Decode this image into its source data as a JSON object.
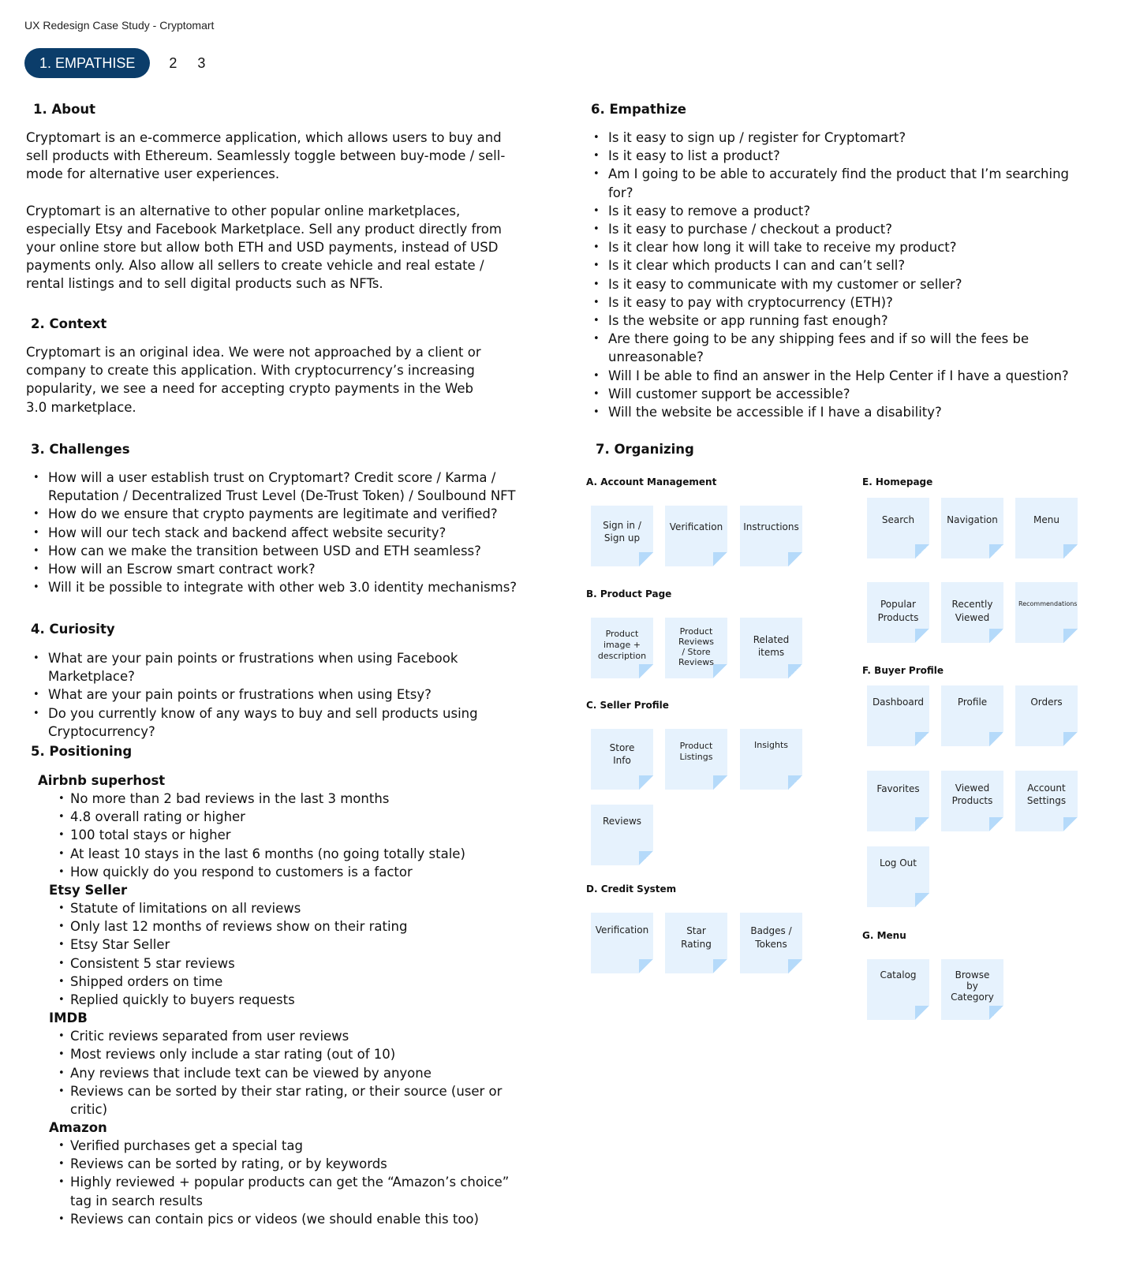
{
  "app_title": "UX Redesign Case Study - Cryptomart",
  "tabs": [
    {
      "label": "1. EMPATHISE",
      "active": true
    },
    {
      "label": "2",
      "active": false
    },
    {
      "label": "3",
      "active": false
    }
  ],
  "colors": {
    "tab_active_bg": "#0b3d6a",
    "sticky_bg": "#e6f2fd",
    "sticky_fold": "#b5dafa"
  },
  "about": {
    "heading": "1. About",
    "paragraphs": [
      "Cryptomart is an e-commerce application, which allows users to buy and sell products with Ethereum. Seamlessly toggle between buy-mode / sell-mode for alternative user experiences.",
      "Cryptomart is an alternative to other popular online marketplaces, especially Etsy and Facebook Marketplace. Sell any product directly from your online store but allow both ETH and USD payments, instead of USD payments only. Also allow all sellers to create vehicle and real estate / rental listings and to sell digital products such as NFTs."
    ]
  },
  "context": {
    "heading": "2. Context",
    "paragraph": "Cryptomart is an original idea. We were not approached by a client or company to create this application. With cryptocurrency’s increasing popularity, we see a need for accepting crypto payments in the Web 3.0 marketplace."
  },
  "challenges": {
    "heading": "3. Challenges",
    "items": [
      "How will a user establish trust on Cryptomart? Credit score / Karma / Reputation / Decentralized Trust Level (De-Trust Token) / Soulbound NFT",
      "How do we ensure that crypto payments are legitimate and verified?",
      "How will our tech stack and backend affect website security?",
      "How can we make the transition between USD and ETH seamless?",
      "How will an Escrow smart contract work?",
      "Will it be possible to integrate with other web 3.0 identity mechanisms?"
    ]
  },
  "curiosity": {
    "heading": "4. Curiosity",
    "items": [
      "What are your pain points or frustrations when using Facebook Marketplace?",
      "What are your pain points or frustrations when using Etsy?",
      "Do you currently know of any ways to buy and sell products using Cryptocurrency?"
    ]
  },
  "positioning": {
    "heading": "5. Positioning",
    "groups": [
      {
        "title": "Airbnb superhost",
        "items": [
          "No more than 2 bad reviews in the last 3 months",
          "4.8 overall rating or higher",
          "100 total stays or higher",
          "At least 10 stays in the last 6 months (no going totally stale)",
          "How quickly do you respond to customers is a factor"
        ]
      },
      {
        "title": "Etsy Seller",
        "items": [
          "Statute of limitations on all reviews",
          "Only last 12 months of reviews show on their rating",
          "Etsy Star Seller",
          "Consistent 5 star reviews",
          "Shipped orders on time",
          "Replied quickly to buyers requests"
        ]
      },
      {
        "title": "IMDB",
        "items": [
          "Critic reviews separated from user reviews",
          "Most reviews only include a star rating (out of 10)",
          "Any reviews that include text can be viewed by anyone",
          "Reviews can be sorted by their star rating, or their source (user or critic)"
        ]
      },
      {
        "title": "Amazon",
        "items": [
          "Verified purchases get a special tag",
          "Reviews can be sorted by rating, or by keywords",
          "Highly reviewed + popular products can get the “Amazon’s choice” tag in search results",
          "Reviews can contain pics or videos (we should enable this too)"
        ]
      }
    ]
  },
  "empathize": {
    "heading": "6. Empathize",
    "items": [
      "Is it easy to sign up / register for Cryptomart?",
      "Is it easy to list a product?",
      "Am I going to be able to accurately find the product that I’m searching for?",
      "Is it easy to remove a product?",
      "Is it easy to purchase / checkout a product?",
      "Is it clear how long it will take to receive my product?",
      "Is it clear which products I can and can’t sell?",
      "Is it easy to communicate with my customer or seller?",
      "Is it easy to pay with cryptocurrency (ETH)?",
      "Is the website or app running fast enough?",
      "Are there going to be any shipping fees and if so will the fees be unreasonable?",
      "Will I be able to find an answer in the Help Center if I have a question?",
      "Will customer support be accessible?",
      "Will the website be accessible if I have a disability?"
    ]
  },
  "organizing": {
    "heading": "7. Organizing",
    "groups": [
      {
        "title": "A. Account Management",
        "notes": [
          "Sign in / Sign up",
          "Verification",
          "Instructions"
        ]
      },
      {
        "title": "B. Product Page",
        "notes": [
          "Product image + description",
          "Product Reviews / Store Reviews",
          "Related items"
        ]
      },
      {
        "title": "C. Seller Profile",
        "notes": [
          "Store Info",
          "Product Listings",
          "Insights",
          "Reviews"
        ]
      },
      {
        "title": "D. Credit System",
        "notes": [
          "Verification",
          "Star Rating",
          "Badges / Tokens"
        ]
      },
      {
        "title": "E. Homepage",
        "notes": [
          "Search",
          "Navigation",
          "Menu",
          "Popular Products",
          "Recently Viewed",
          "Recommendations"
        ]
      },
      {
        "title": "F. Buyer Profile",
        "notes": [
          "Dashboard",
          "Profile",
          "Orders",
          "Favorites",
          "Viewed Products",
          "Account Settings",
          "Log Out"
        ]
      },
      {
        "title": "G. Menu",
        "notes": [
          "Catalog",
          "Browse by Category"
        ]
      }
    ]
  }
}
